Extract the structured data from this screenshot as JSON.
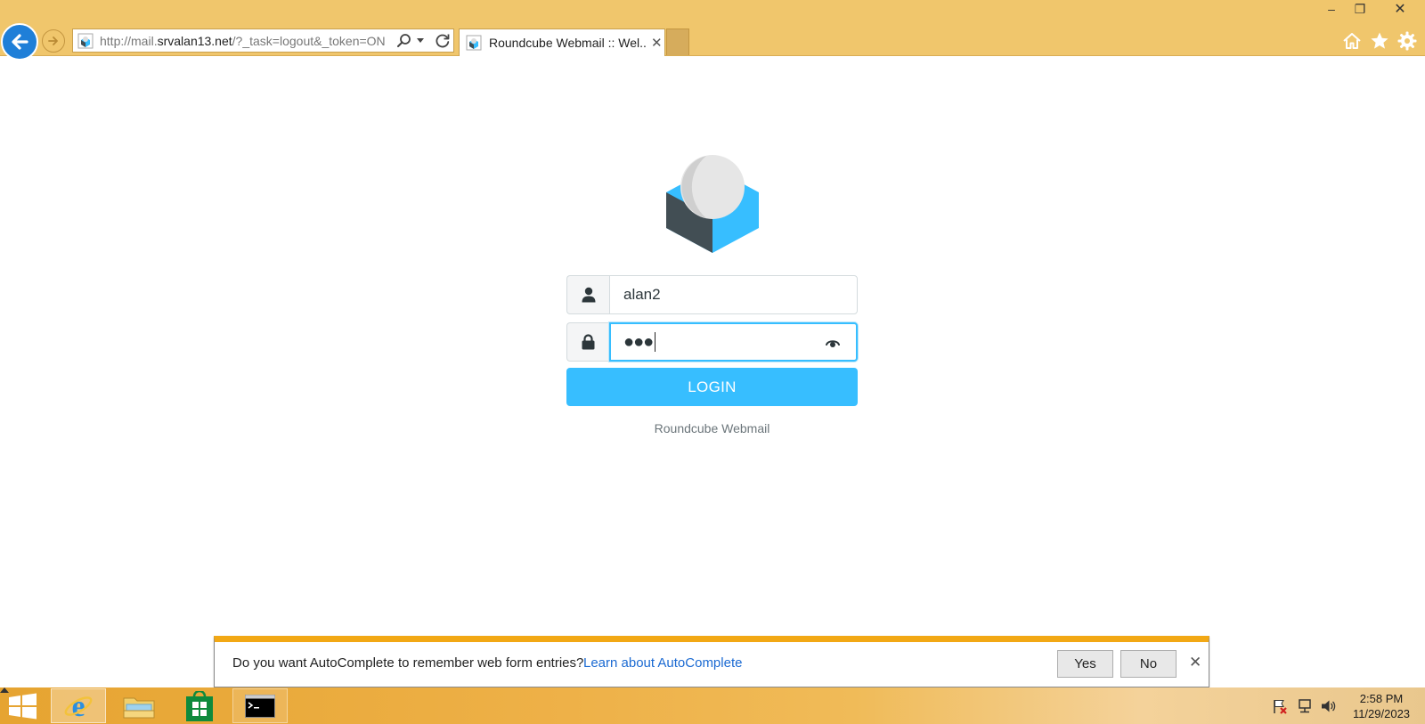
{
  "browser": {
    "url_prefix": "http://mail.",
    "url_host": "srvalan13.net",
    "url_rest": "/?_task=logout&_token=ON",
    "tab_title": "Roundcube Webmail :: Wel...",
    "tab_close": "✕",
    "win_minimize": "–",
    "win_restore": "❐",
    "win_close": "✕"
  },
  "login": {
    "username_value": "alan2",
    "password_mask": "●●●",
    "login_label": "LOGIN",
    "product_name": "Roundcube Webmail"
  },
  "autocomplete_bar": {
    "message": "Do you want AutoComplete to remember web form entries?",
    "link": "Learn about AutoComplete",
    "yes_label": "Yes",
    "no_label": "No",
    "close": "✕"
  },
  "taskbar": {
    "items": [
      "internet-explorer",
      "file-explorer",
      "store",
      "command-prompt"
    ],
    "time": "2:58 PM",
    "date": "11/29/2023"
  },
  "colors": {
    "chrome": "#f0c66c",
    "accent": "#37beff",
    "notification_bar": "#f2a815",
    "back_button": "#1f7fd8"
  }
}
